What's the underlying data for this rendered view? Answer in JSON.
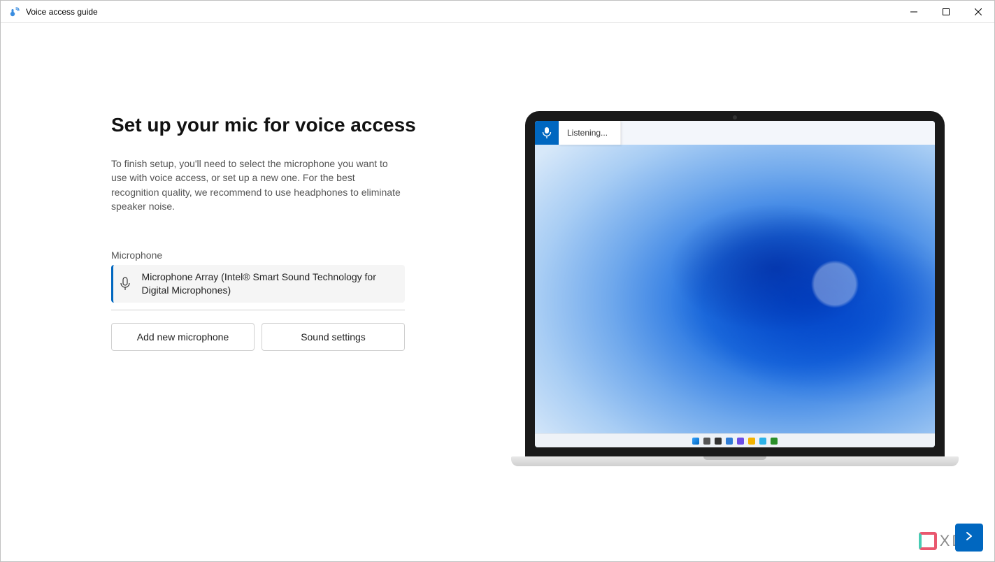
{
  "window": {
    "title": "Voice access guide"
  },
  "page": {
    "heading": "Set up your mic for voice access",
    "description": "To finish setup, you'll need to select the microphone you want to use with voice access, or set up a new one. For the best recognition quality, we recommend to use headphones to eliminate speaker noise."
  },
  "mic": {
    "label": "Microphone",
    "selected": "Microphone Array (Intel® Smart Sound Technology for Digital Microphones)"
  },
  "buttons": {
    "add": "Add new microphone",
    "sound_settings": "Sound settings"
  },
  "illustration": {
    "status": "Listening..."
  },
  "watermark": {
    "text": "XDA"
  },
  "colors": {
    "accent": "#0067c0"
  }
}
